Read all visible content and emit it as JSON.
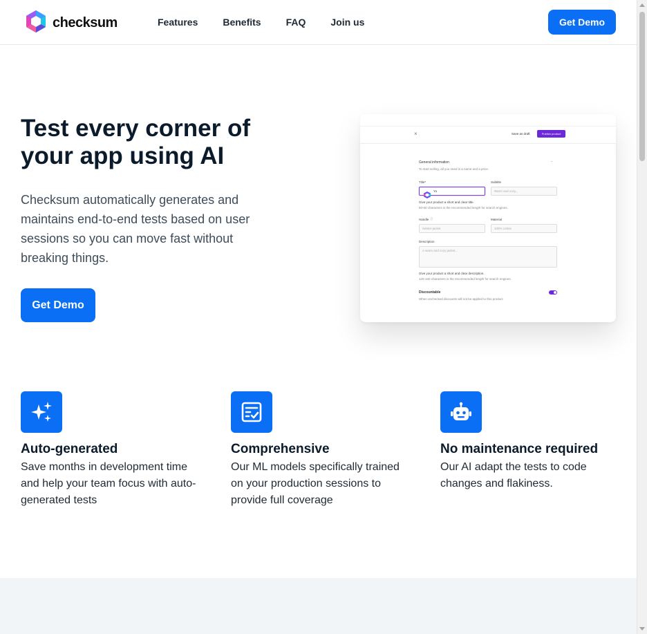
{
  "header": {
    "brand": "checksum",
    "nav": [
      "Features",
      "Benefits",
      "FAQ",
      "Join us"
    ],
    "cta": "Get Demo"
  },
  "hero": {
    "title": "Test every corner of your app using AI",
    "subtitle": "Checksum automatically generates and maintains end-to-end tests based on user sessions so you can move fast without breaking things.",
    "cta": "Get Demo"
  },
  "preview": {
    "close": "×",
    "save": "Save as draft",
    "publish": "Publish product",
    "section_title": "General information",
    "section_hint": "To start selling, all you need is a name and a price.",
    "title_label": "Title*",
    "title_value": "Yo",
    "subtitle_label": "Subtitle",
    "subtitle_placeholder": "Warm and cozy...",
    "title_help1": "Give your product a short and clear title.",
    "title_help2": "50-60 characters is the recommended length for search engines.",
    "handle_label": "Handle",
    "handle_placeholder": "/winter-jacket",
    "material_label": "Material",
    "material_placeholder": "100% cotton",
    "description_label": "Description",
    "description_placeholder": "A warm and cozy jacket...",
    "desc_help1": "Give your product a short and clear description.",
    "desc_help2": "120-160 characters is the recommended length for search engines.",
    "discountable_label": "Discountable",
    "discountable_hint": "When unchecked discounts will not be applied to this product"
  },
  "features": [
    {
      "icon": "sparkles-icon",
      "title": "Auto-generated",
      "desc": "Save months in development time and help your team focus with auto-generated tests"
    },
    {
      "icon": "checklist-icon",
      "title": "Comprehensive",
      "desc": "Our ML models specifically trained on your production sessions to provide full coverage"
    },
    {
      "icon": "robot-icon",
      "title": "No maintenance required",
      "desc": "Our AI adapt the tests to code changes and flakiness."
    }
  ],
  "colors": {
    "accent": "#0a6ff5",
    "publish": "#6d28d9",
    "band": "#f2f5f8"
  }
}
